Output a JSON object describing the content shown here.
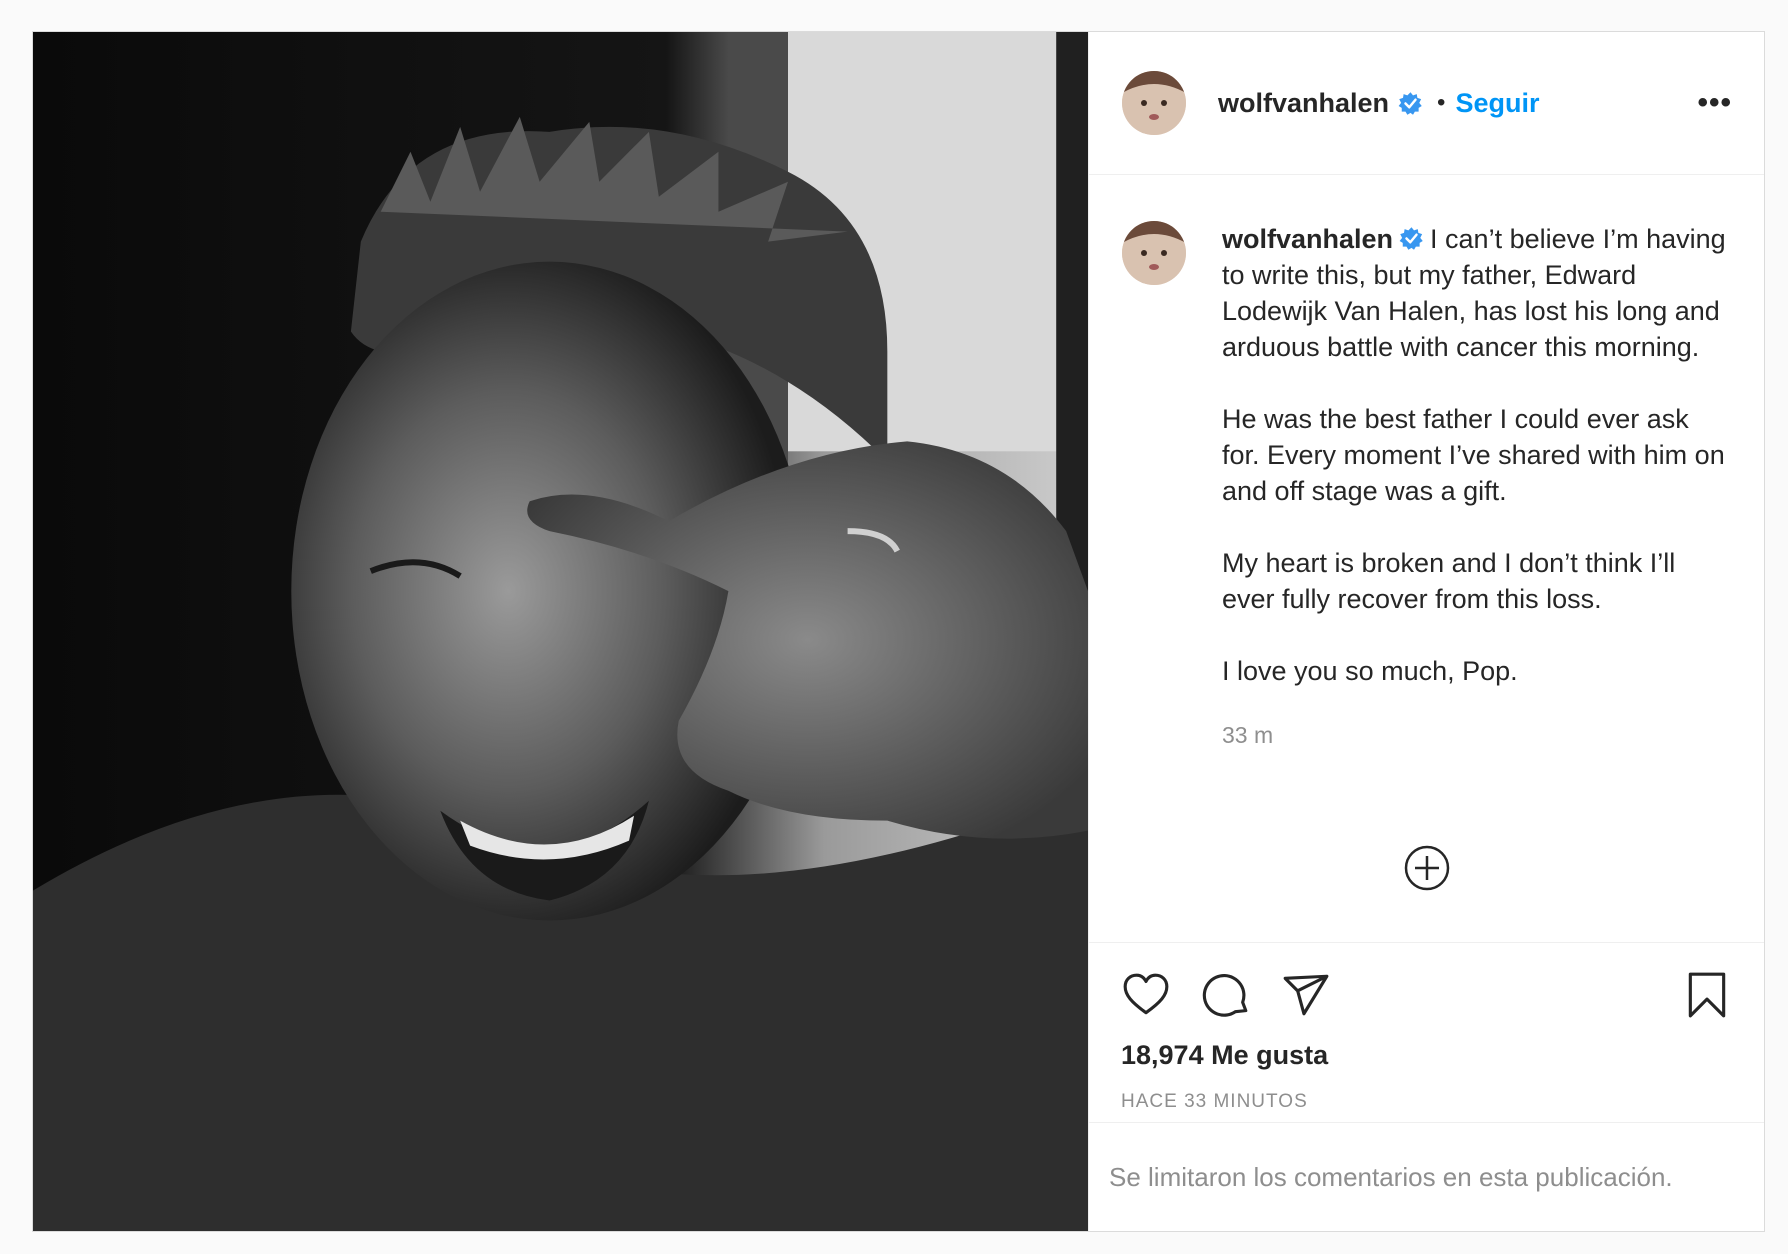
{
  "header": {
    "username": "wolfvanhalen",
    "separator": "•",
    "follow_label": "Seguir",
    "more_label": "•••"
  },
  "caption": {
    "username": "wolfvanhalen",
    "lines": [
      "I can’t believe I’m having to write this, but my father, Edward Lodewijk Van Halen, has lost his long and arduous battle with cancer this morning.",
      "He was the best father I could ever ask for. Every moment I’ve shared with him on and off stage was a gift.",
      "My heart is broken and I don’t think I’ll ever fully recover from this loss.",
      "I love you so much, Pop."
    ],
    "time": "33 m"
  },
  "actions": {
    "icons": [
      "heart-icon",
      "comment-icon",
      "share-icon",
      "bookmark-icon"
    ],
    "likes": "18,974 Me gusta",
    "posted": "HACE 33 MINUTOS"
  },
  "footer": {
    "comments_limited": "Se limitaron los comentarios en esta publicación."
  },
  "colors": {
    "accent": "#0095f6",
    "text": "#262626",
    "muted": "#8e8e8e",
    "verified": "#3897f0"
  }
}
